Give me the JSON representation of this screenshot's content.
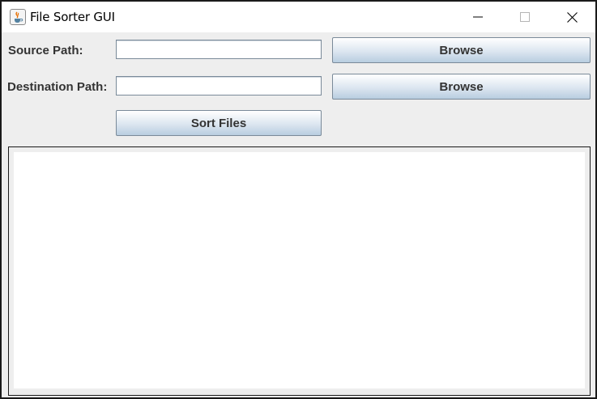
{
  "window": {
    "title": "File Sorter GUI",
    "icon": "java-cup-icon"
  },
  "form": {
    "source_label": "Source Path:",
    "source_value": "",
    "destination_label": "Destination Path:",
    "destination_value": "",
    "browse_label": "Browse",
    "sort_label": "Sort Files"
  },
  "log": {
    "text": ""
  },
  "colors": {
    "background": "#eeeeee",
    "button_gradient_top": "#ffffff",
    "button_gradient_bottom": "#b8cde0",
    "border": "#7a8a99"
  }
}
